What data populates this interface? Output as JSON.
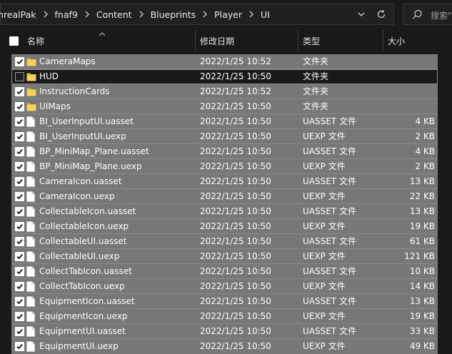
{
  "breadcrumb": [
    "nrealPak",
    "fnaf9",
    "Content",
    "Blueprints",
    "Player",
    "UI"
  ],
  "search": {
    "placeholder": "搜索\""
  },
  "columns": {
    "name": "名称",
    "date": "修改日期",
    "type": "类型",
    "size": "大小"
  },
  "colors": {
    "accent_folder": "#f0c040",
    "selected_row": "#777777"
  },
  "files": [
    {
      "name": "CameraMaps",
      "date": "2022/1/25 10:52",
      "type": "文件夹",
      "size": "",
      "kind": "folder",
      "checked": true
    },
    {
      "name": "HUD",
      "date": "2022/1/25 10:50",
      "type": "文件夹",
      "size": "",
      "kind": "folder",
      "checked": false
    },
    {
      "name": "InstructionCards",
      "date": "2022/1/25 10:52",
      "type": "文件夹",
      "size": "",
      "kind": "folder",
      "checked": true
    },
    {
      "name": "UIMaps",
      "date": "2022/1/25 10:50",
      "type": "文件夹",
      "size": "",
      "kind": "folder",
      "checked": true
    },
    {
      "name": "BI_UserInputUI.uasset",
      "date": "2022/1/25 10:50",
      "type": "UASSET 文件",
      "size": "4 KB",
      "kind": "file",
      "checked": true
    },
    {
      "name": "BI_UserInputUI.uexp",
      "date": "2022/1/25 10:50",
      "type": "UEXP 文件",
      "size": "2 KB",
      "kind": "file",
      "checked": true
    },
    {
      "name": "BP_MiniMap_Plane.uasset",
      "date": "2022/1/25 10:50",
      "type": "UASSET 文件",
      "size": "4 KB",
      "kind": "file",
      "checked": true
    },
    {
      "name": "BP_MiniMap_Plane.uexp",
      "date": "2022/1/25 10:50",
      "type": "UEXP 文件",
      "size": "2 KB",
      "kind": "file",
      "checked": true
    },
    {
      "name": "CameraIcon.uasset",
      "date": "2022/1/25 10:50",
      "type": "UASSET 文件",
      "size": "13 KB",
      "kind": "file",
      "checked": true
    },
    {
      "name": "CameraIcon.uexp",
      "date": "2022/1/25 10:50",
      "type": "UEXP 文件",
      "size": "22 KB",
      "kind": "file",
      "checked": true
    },
    {
      "name": "CollectableIcon.uasset",
      "date": "2022/1/25 10:50",
      "type": "UASSET 文件",
      "size": "13 KB",
      "kind": "file",
      "checked": true
    },
    {
      "name": "CollectableIcon.uexp",
      "date": "2022/1/25 10:50",
      "type": "UEXP 文件",
      "size": "19 KB",
      "kind": "file",
      "checked": true
    },
    {
      "name": "CollectableUI.uasset",
      "date": "2022/1/25 10:50",
      "type": "UASSET 文件",
      "size": "61 KB",
      "kind": "file",
      "checked": true
    },
    {
      "name": "CollectableUI.uexp",
      "date": "2022/1/25 10:50",
      "type": "UEXP 文件",
      "size": "121 KB",
      "kind": "file",
      "checked": true
    },
    {
      "name": "CollectTabIcon.uasset",
      "date": "2022/1/25 10:50",
      "type": "UASSET 文件",
      "size": "10 KB",
      "kind": "file",
      "checked": true
    },
    {
      "name": "CollectTabIcon.uexp",
      "date": "2022/1/25 10:50",
      "type": "UEXP 文件",
      "size": "14 KB",
      "kind": "file",
      "checked": true
    },
    {
      "name": "EquipmentIcon.uasset",
      "date": "2022/1/25 10:50",
      "type": "UASSET 文件",
      "size": "13 KB",
      "kind": "file",
      "checked": true
    },
    {
      "name": "EquipmentIcon.uexp",
      "date": "2022/1/25 10:50",
      "type": "UEXP 文件",
      "size": "19 KB",
      "kind": "file",
      "checked": true
    },
    {
      "name": "EquipmentUI.uasset",
      "date": "2022/1/25 10:50",
      "type": "UASSET 文件",
      "size": "33 KB",
      "kind": "file",
      "checked": true
    },
    {
      "name": "EquipmentUI.uexp",
      "date": "2022/1/25 10:50",
      "type": "UEXP 文件",
      "size": "49 KB",
      "kind": "file",
      "checked": true
    }
  ]
}
